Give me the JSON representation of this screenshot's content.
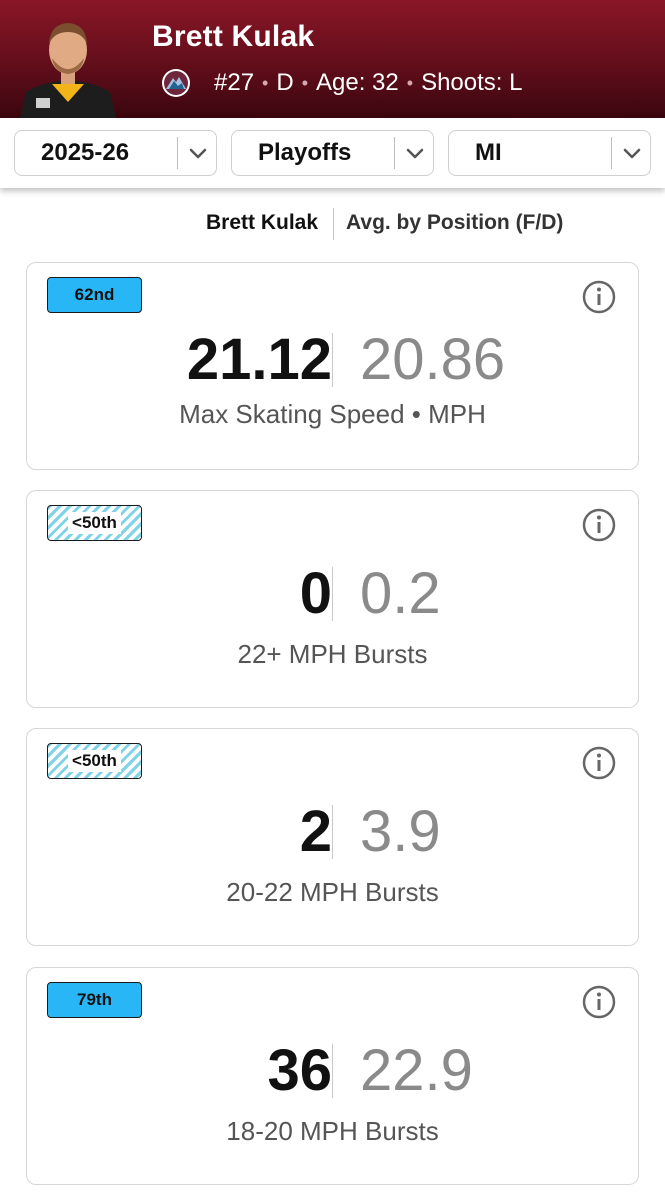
{
  "player": {
    "name": "Brett Kulak",
    "number": "#27",
    "position": "D",
    "age": "Age: 32",
    "shoots": "Shoots: L",
    "team_logo": "avalanche-logo-icon"
  },
  "filters": {
    "season": "2025-26",
    "game_type": "Playoffs",
    "strength": "MI"
  },
  "legend": {
    "player_label": "Brett Kulak",
    "average_label": "Avg. by Position (F/D)"
  },
  "cards": [
    {
      "badge": "62nd",
      "badge_style": "solid",
      "player_value": "21.12",
      "avg_value": "20.86",
      "label": "Max Skating Speed • MPH"
    },
    {
      "badge": "<50th",
      "badge_style": "hatched",
      "player_value": "0",
      "avg_value": "0.2",
      "label": "22+ MPH Bursts"
    },
    {
      "badge": "<50th",
      "badge_style": "hatched",
      "player_value": "2",
      "avg_value": "3.9",
      "label": "20-22 MPH Bursts"
    },
    {
      "badge": "79th",
      "badge_style": "solid",
      "player_value": "36",
      "avg_value": "22.9",
      "label": "18-20 MPH Bursts"
    }
  ],
  "colors": {
    "header_maroon": "#6f1020",
    "badge_blue": "#29b6f6",
    "hatch_teal": "#7fd3e6",
    "avg_gray": "#8a8a8a"
  }
}
